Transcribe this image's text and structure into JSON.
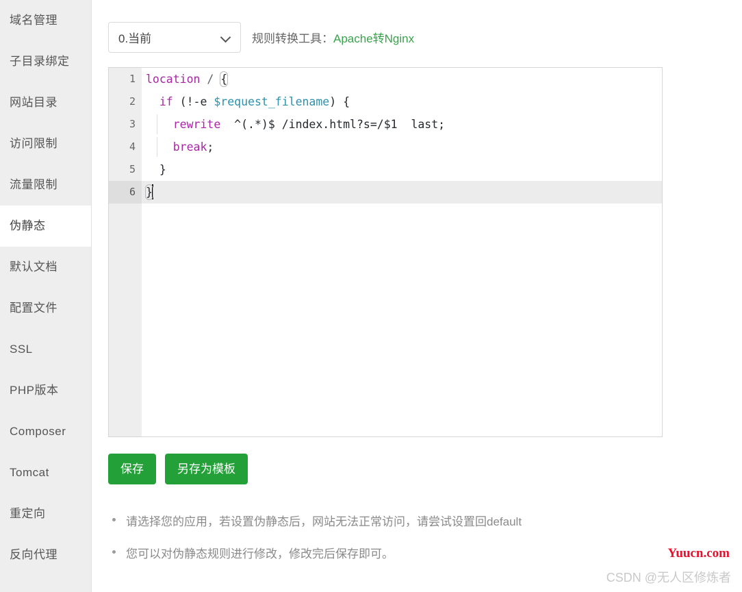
{
  "sidebar": {
    "items": [
      {
        "label": "域名管理",
        "active": false
      },
      {
        "label": "子目录绑定",
        "active": false
      },
      {
        "label": "网站目录",
        "active": false
      },
      {
        "label": "访问限制",
        "active": false
      },
      {
        "label": "流量限制",
        "active": false
      },
      {
        "label": "伪静态",
        "active": true
      },
      {
        "label": "默认文档",
        "active": false
      },
      {
        "label": "配置文件",
        "active": false
      },
      {
        "label": "SSL",
        "active": false
      },
      {
        "label": "PHP版本",
        "active": false
      },
      {
        "label": "Composer",
        "active": false
      },
      {
        "label": "Tomcat",
        "active": false
      },
      {
        "label": "重定向",
        "active": false
      },
      {
        "label": "反向代理",
        "active": false
      }
    ]
  },
  "toolbar": {
    "select_value": "0.当前",
    "select_icon": "chevron-down-icon",
    "converter_label": "规则转换工具：",
    "converter_link": "Apache转Nginx",
    "link_color": "#37a34a"
  },
  "editor": {
    "lines": [
      {
        "number": "1",
        "text": "location / {"
      },
      {
        "number": "2",
        "text": "  if (!-e $request_filename) {"
      },
      {
        "number": "3",
        "text": "    rewrite  ^(.*)$ /index.html?s=/$1  last;"
      },
      {
        "number": "4",
        "text": "    break;"
      },
      {
        "number": "5",
        "text": "  }"
      },
      {
        "number": "6",
        "text": "}"
      }
    ],
    "active_line": "6",
    "cursor_line": "6",
    "language": "nginx"
  },
  "buttons": {
    "save_label": "保存",
    "save_as_template_label": "另存为模板",
    "color": "#23a138"
  },
  "notes": [
    "请选择您的应用，若设置伪静态后，网站无法正常访问，请尝试设置回default",
    "您可以对伪静态规则进行修改，修改完后保存即可。"
  ],
  "watermarks": {
    "site": "Yuucn.com",
    "site_color": "#e8112d",
    "credit": "CSDN @无人区修炼者"
  }
}
